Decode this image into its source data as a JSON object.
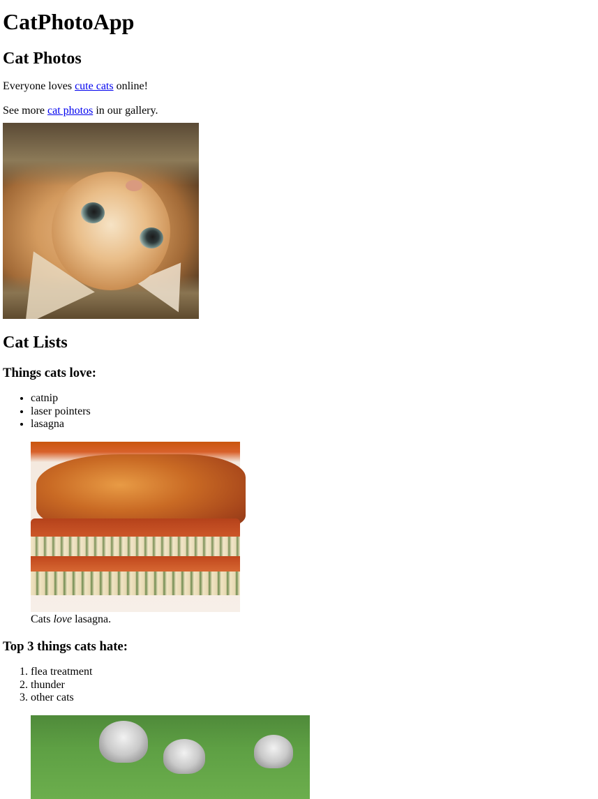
{
  "main": {
    "app_title": "CatPhotoApp",
    "section_photos": {
      "heading": "Cat Photos",
      "para1": {
        "before": "Everyone loves ",
        "link": "cute cats",
        "after": " online!"
      },
      "para2": {
        "before": "See more ",
        "link": "cat photos",
        "after": " in our gallery."
      }
    },
    "section_lists": {
      "heading": "Cat Lists",
      "love_heading": "Things cats love:",
      "love_items": [
        "catnip",
        "laser pointers",
        "lasagna"
      ],
      "lasagna_caption": {
        "before": "Cats ",
        "em": "love",
        "after": " lasagna."
      },
      "hate_heading": "Top 3 things cats hate:",
      "hate_items": [
        "flea treatment",
        "thunder",
        "other cats"
      ]
    }
  },
  "colors": {
    "link": "#0000ee",
    "text": "#000000",
    "background": "#ffffff"
  }
}
